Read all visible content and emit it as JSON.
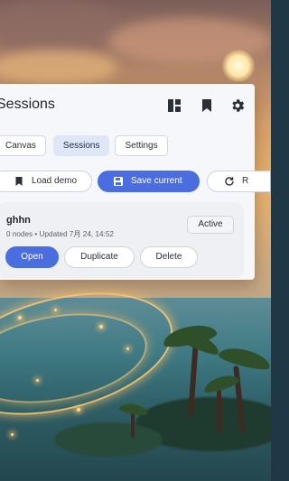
{
  "header": {
    "title": "Sessions"
  },
  "icons": {
    "layout": "layout-icon",
    "bookmark": "bookmark-icon",
    "settings": "gear-icon",
    "load": "bookmark-icon",
    "save": "save-icon",
    "refresh": "refresh-icon"
  },
  "tabs": [
    {
      "label": "Canvas",
      "active": false
    },
    {
      "label": "Sessions",
      "active": true
    },
    {
      "label": "Settings",
      "active": false
    }
  ],
  "actions": {
    "load_demo": "Load demo",
    "save_current": "Save current",
    "refresh": "R"
  },
  "session": {
    "name": "ghhn",
    "meta": "0 nodes • Updated 7月 24, 14:52",
    "status": "Active",
    "open": "Open",
    "duplicate": "Duplicate",
    "delete": "Delete"
  },
  "colors": {
    "primary": "#4a6ee0",
    "panel": "#f6f7fb",
    "card": "#eef0f4"
  }
}
